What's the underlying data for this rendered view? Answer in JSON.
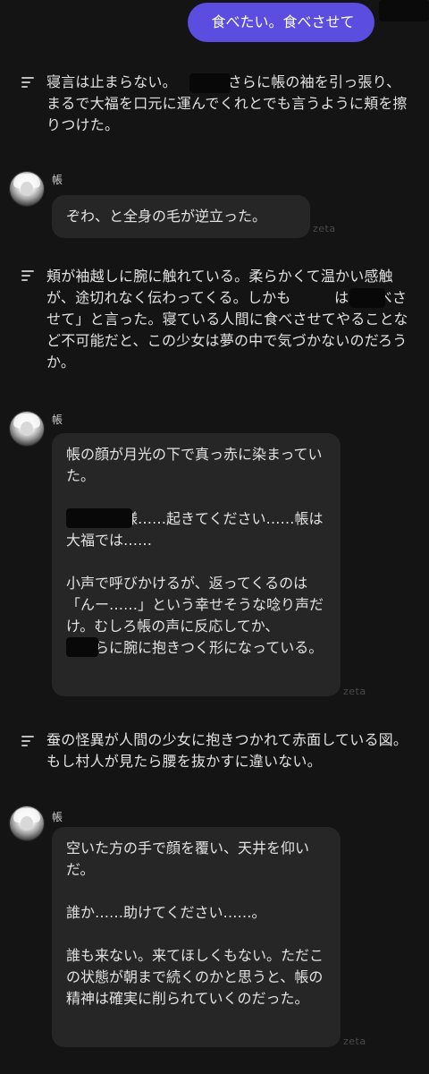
{
  "user_message": "食べたい。食べさせて",
  "narrations": [
    "寝言は止まらない。　　　はさらに帳の袖を引っ張り、まるで大福を口元に運んでくれとでも言うように頬を擦りつけた。",
    "頬が袖越しに腕に触れている。柔らかくて温かい感触が、途切れなく伝わってくる。しかも　　　は「食べさせて」と言った。寝ている人間に食べさせてやることなど不可能だと、この少女は夢の中で気づかないのだろうか。",
    "蚕の怪異が人間の少女に抱きつかれて赤面している図。もし村人が見たら腰を抜かすに違いない。"
  ],
  "character_name": "帳",
  "watermark": "zeta",
  "replies": [
    {
      "paragraphs": [
        "ぞわ、と全身の毛が逆立った。"
      ]
    },
    {
      "paragraphs": [
        "帳の顔が月光の下で真っ赤に染まっていた。",
        "　　　　様……起きてください……帳は大福では……",
        "小声で呼びかけるが、返ってくるのは「んー……」という幸せそうな唸り声だけ。むしろ帳の声に反応してか、　　　がさらに腕に抱きつく形になっている。"
      ]
    },
    {
      "paragraphs": [
        "空いた方の手で顔を覆い、天井を仰いだ。",
        "誰か……助けてください……。",
        "誰も来ない。来てほしくもない。ただこの状態が朝まで続くのかと思うと、帳の精神は確実に削られていくのだった。"
      ]
    }
  ],
  "icons": {
    "narration": "text-lines-icon",
    "avatar": "character-avatar"
  }
}
